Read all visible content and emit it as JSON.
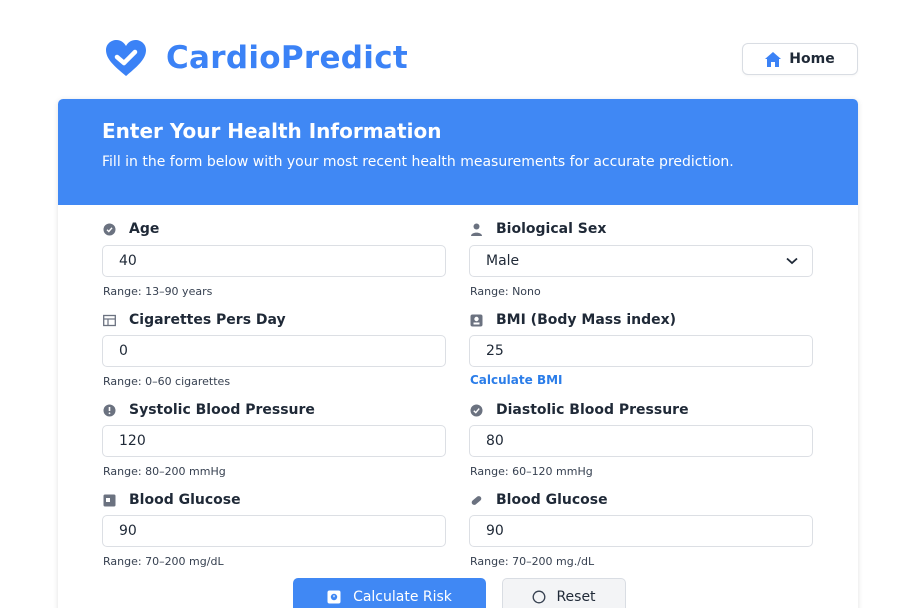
{
  "header": {
    "brand": "CardioPredict",
    "home_label": "Home"
  },
  "card": {
    "title": "Enter Your Health Information",
    "subtitle": "Fill in the form below with your most recent health measurements for accurate prediction."
  },
  "form": {
    "age": {
      "label": "Age",
      "value": "40",
      "hint": "Range: 13–90 years"
    },
    "sex": {
      "label": "Biological Sex",
      "value": "Male",
      "hint": "Range: Nono"
    },
    "cigarettes": {
      "label": "Cigarettes Pers Day",
      "value": "0",
      "hint": "Range: 0–60 cigarettes"
    },
    "bmi": {
      "label": "BMI (Body Mass index)",
      "value": "25",
      "link": "Calculate  BMI"
    },
    "systolic": {
      "label": "Systolic Blood Pressure",
      "value": "120",
      "hint": "Range: 80–200 mmHg"
    },
    "diastolic": {
      "label": "Diastolic Blood Pressure",
      "value": "80",
      "hint": "Range: 60–120 mmHg"
    },
    "glucose_left": {
      "label": "Blood Glucose",
      "value": "90",
      "hint": "Range: 70–200 mg/dL"
    },
    "glucose_right": {
      "label": "Blood Glucose",
      "value": "90",
      "hint": "Range: 70–200 mg./dL"
    }
  },
  "actions": {
    "calculate_label": "Calculate Risk",
    "reset_label": "Reset"
  },
  "colors": {
    "brand": "#3b82f6",
    "header_bg": "#4088f4",
    "link": "#2b7de9"
  },
  "icons": {
    "brand": "heart-check-icon",
    "home": "house-icon",
    "age": "clock-circle-icon",
    "sex": "person-icon",
    "cigarettes": "cigarette-box-icon",
    "bmi": "scale-icon",
    "systolic": "gauge-icon",
    "diastolic": "check-circle-icon",
    "glucose_left": "calendar-icon",
    "glucose_right": "pill-icon",
    "calculate": "calculator-icon",
    "reset": "circle-icon",
    "select": "chevron-down-icon"
  }
}
